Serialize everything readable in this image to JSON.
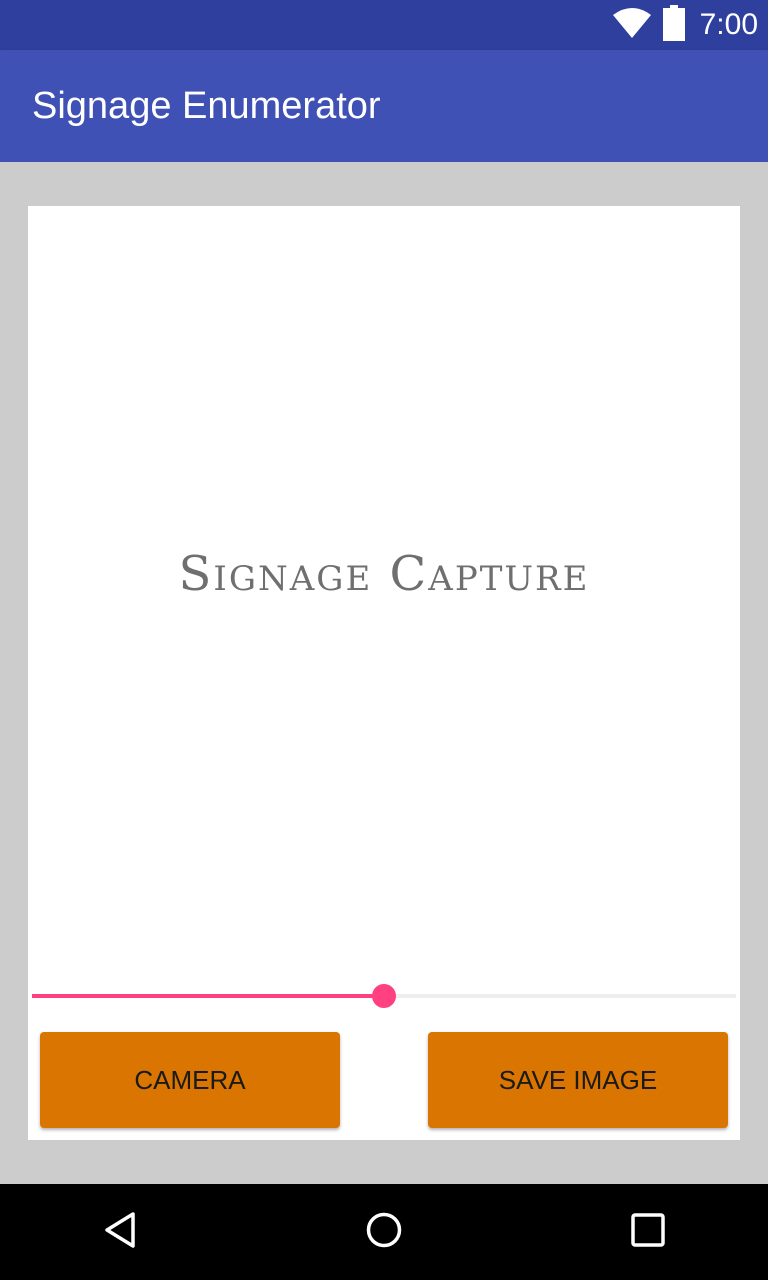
{
  "status_bar": {
    "time": "7:00",
    "icons": [
      "wifi-icon",
      "battery-icon"
    ]
  },
  "app_bar": {
    "title": "Signage Enumerator",
    "color": "#3f51b5"
  },
  "capture": {
    "placeholder_text": "Signage Capture"
  },
  "slider": {
    "value_fraction": 0.5,
    "accent_color": "#ff4081"
  },
  "buttons": {
    "camera_label": "CAMERA",
    "save_label": "SAVE IMAGE",
    "color": "#d97500"
  },
  "nav_bar": {
    "icons": [
      "back-icon",
      "home-icon",
      "recents-icon"
    ]
  }
}
